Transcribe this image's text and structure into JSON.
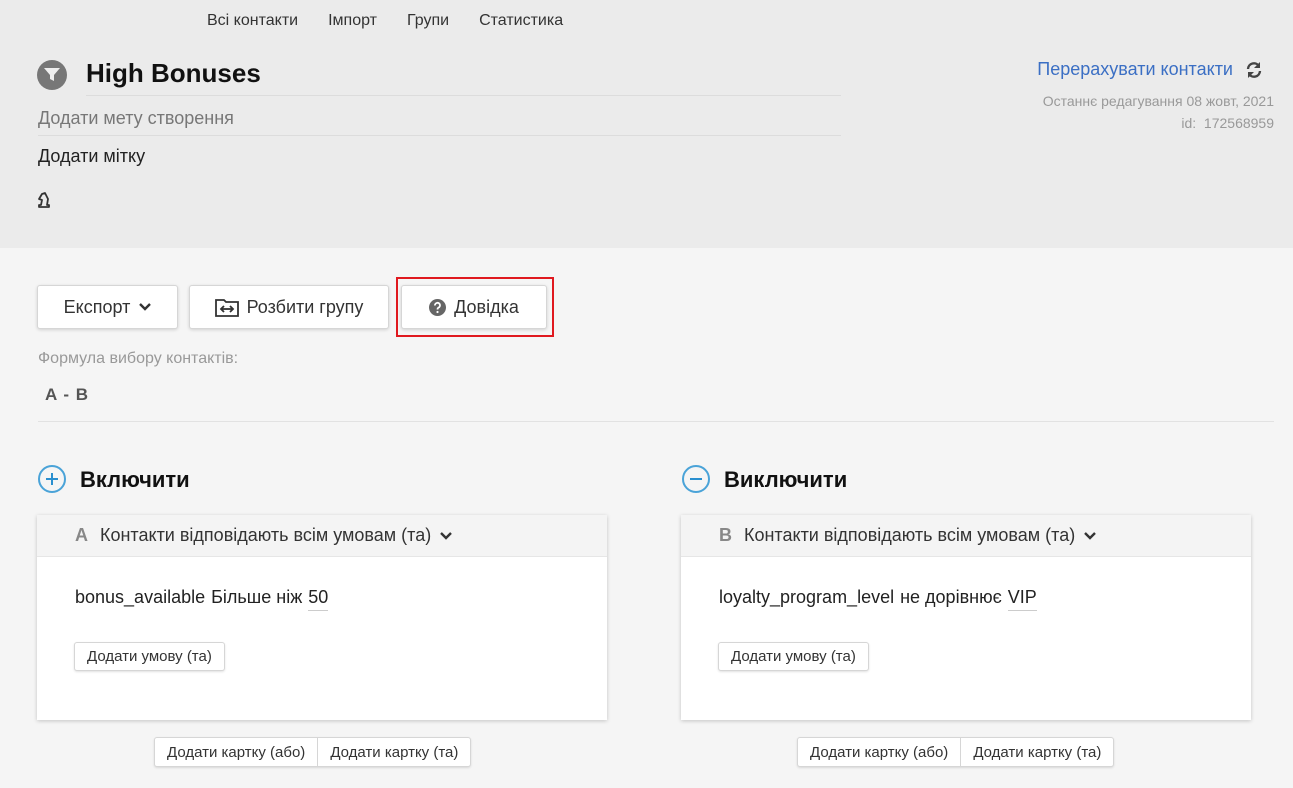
{
  "nav": {
    "items": [
      "Всі контакти",
      "Імпорт",
      "Групи",
      "Статистика"
    ]
  },
  "group": {
    "title": "High Bonuses",
    "goal_placeholder": "Додати мету створення",
    "tag_placeholder": "Додати мітку",
    "recount_label": "Перерахувати контакти",
    "edited": "Останнє редагування 08 жовт, 2021",
    "id_label": "id:",
    "id_value": "172568959"
  },
  "toolbar": {
    "export_label": "Експорт",
    "split_label": "Розбити групу",
    "help_label": "Довідка"
  },
  "formula": {
    "label": "Формула вибору контактів:",
    "value": "A - B"
  },
  "include": {
    "title": "Включити",
    "card": {
      "letter": "A",
      "mode": "Контакти відповідають всім умовам (та)",
      "condition": {
        "field": "bonus_available",
        "operator": "Більше ніж",
        "value": "50"
      },
      "add_condition": "Додати умову (та)"
    },
    "add_card_or": "Додати картку (або)",
    "add_card_and": "Додати картку (та)"
  },
  "exclude": {
    "title": "Виключити",
    "card": {
      "letter": "B",
      "mode": "Контакти відповідають всім умовам (та)",
      "condition": {
        "field": "loyalty_program_level",
        "operator": "не дорівнює",
        "value": "VIP"
      },
      "add_condition": "Додати умову (та)"
    },
    "add_card_or": "Додати картку (або)",
    "add_card_and": "Додати картку (та)"
  },
  "colors": {
    "accent": "#3b6fc4",
    "icon_blue": "#2a8fcf",
    "highlight": "#e0191f"
  }
}
